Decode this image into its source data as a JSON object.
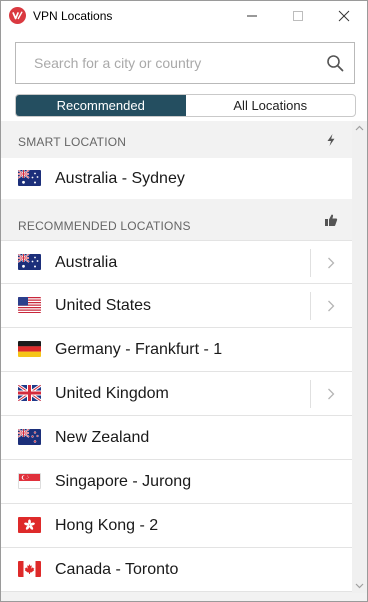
{
  "window": {
    "title": "VPN Locations"
  },
  "search": {
    "placeholder": "Search for a city or country"
  },
  "tabs": [
    {
      "label": "Recommended",
      "active": true
    },
    {
      "label": "All Locations",
      "active": false
    }
  ],
  "smart_location": {
    "header": "SMART LOCATION",
    "header_icon": "lightning-icon",
    "item": {
      "name": "Australia - Sydney",
      "flag": "australia-flag"
    }
  },
  "recommended": {
    "header": "RECOMMENDED LOCATIONS",
    "header_icon": "thumbs-up-icon",
    "items": [
      {
        "name": "Australia",
        "flag": "australia-flag",
        "expandable": true
      },
      {
        "name": "United States",
        "flag": "united-states-flag",
        "expandable": true
      },
      {
        "name": "Germany - Frankfurt - 1",
        "flag": "germany-flag",
        "expandable": false
      },
      {
        "name": "United Kingdom",
        "flag": "united-kingdom-flag",
        "expandable": true
      },
      {
        "name": "New Zealand",
        "flag": "new-zealand-flag",
        "expandable": false
      },
      {
        "name": "Singapore - Jurong",
        "flag": "singapore-flag",
        "expandable": false
      },
      {
        "name": "Hong Kong - 2",
        "flag": "hong-kong-flag",
        "expandable": false
      },
      {
        "name": "Canada - Toronto",
        "flag": "canada-flag",
        "expandable": false
      }
    ]
  },
  "colors": {
    "active_tab": "#244e60",
    "brand_red": "#da3940",
    "section_bg": "#f2f2f2"
  }
}
